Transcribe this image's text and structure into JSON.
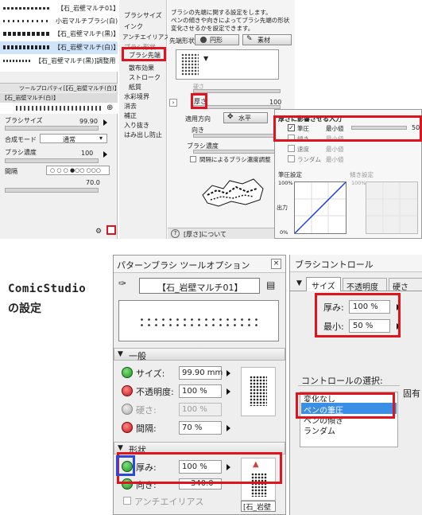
{
  "clip": {
    "brush_list": [
      "【石_岩壁マルチ01】",
      "小岩マルチブラシ(白)",
      "【石_岩壁マルチ(黒)】",
      "【石_岩壁マルチ(白)】",
      "【石_岩壁マルチ(黒)]調整用"
    ],
    "tool_property_title": "ツールプロパティ[【石_岩壁マルチ(白)】",
    "tool_property_brush": "【石_岩壁マルチ(白)】",
    "size_label": "ブラシサイズ",
    "size_value": "99.90",
    "blend_label": "合成モード",
    "blend_value": "通常",
    "density_label": "ブラシ濃度",
    "density_value": "100",
    "spacing_label": "間隔",
    "spacing_value": "70.0",
    "categories": [
      "ブラシサイズ",
      "インク",
      "アンチエイリアス",
      "ブラシ形状",
      "ブラシ先端",
      "散布効果",
      "ストローク",
      "紙質",
      "水彩境界",
      "消去",
      "補正",
      "入り抜き",
      "はみ出し防止"
    ],
    "selected_category": "ブラシ先端",
    "desc_text_1": "ブラシの先端に関する設定をします。",
    "desc_text_2": "ペンの傾きや向きによってブラシ先端の形状",
    "desc_text_3": "変化させるかを設定できます。",
    "tip_shape_label": "先端形状",
    "tip_circle_label": "円形",
    "tip_material_label": "素材",
    "hardness_label": "硬さ",
    "thickness_label": "厚さ",
    "thickness_value": "100",
    "direction_label": "適用方向",
    "direction_value": "水平",
    "angle_label": "向き",
    "brush_density_label": "ブラシ濃度",
    "spacing_adjust_label": "間隔によるブラシ濃度調整",
    "popup_title": "厚さに影響させる入力",
    "popup_rows": [
      {
        "label": "筆圧",
        "min_label": "最小値",
        "value": "50",
        "checked": true
      },
      {
        "label": "傾き",
        "min_label": "最小値",
        "value": "",
        "checked": false
      },
      {
        "label": "速度",
        "min_label": "最小値",
        "value": "",
        "checked": false
      },
      {
        "label": "ランダム",
        "min_label": "最小値",
        "value": "",
        "checked": false
      }
    ],
    "pressure_label": "筆圧設定",
    "tilt_label": "傾き設定",
    "graph_100": "100%",
    "graph_output": "出力",
    "graph_0": "0%",
    "graph_100b": "100%",
    "about_label": "[厚さ]について"
  },
  "caption": {
    "line1": "ComicStudio",
    "line2": "の設定"
  },
  "cs_left": {
    "title": "パターンブラシ ツールオプション",
    "close": "×",
    "brush_name": "【石_岩壁マルチ01】",
    "section_general": "一般",
    "size_label": "サイズ:",
    "size_value": "99.90 mm",
    "opacity_label": "不透明度:",
    "opacity_value": "100 %",
    "hardness_label": "硬さ:",
    "hardness_value": "100 %",
    "spacing_label": "間隔:",
    "spacing_value": "70 %",
    "section_shape": "形状",
    "thickness_label": "厚み:",
    "thickness_value": "100 %",
    "direction_label": "向き:",
    "direction_value": "340.0",
    "antialias_label": "アンチエイリアス",
    "thumb_label": "[石_岩壁"
  },
  "cs_right": {
    "title": "ブラシコントロール",
    "tabs": [
      "サイズ",
      "不透明度",
      "硬さ"
    ],
    "thickness_label": "厚み:",
    "thickness_value": "100 %",
    "min_label": "最小:",
    "min_value": "50 %",
    "control_select_label": "コントロールの選択:",
    "fixed_label": "固有",
    "control_items": [
      "変化なし",
      "ペンの筆圧",
      "ペンの傾き",
      "ランダム"
    ],
    "selected_control": "ペンの筆圧"
  },
  "colors": {
    "highlight": "#e0141e",
    "selection": "#3a8ee6",
    "blue_box": "#2b4bd6"
  }
}
